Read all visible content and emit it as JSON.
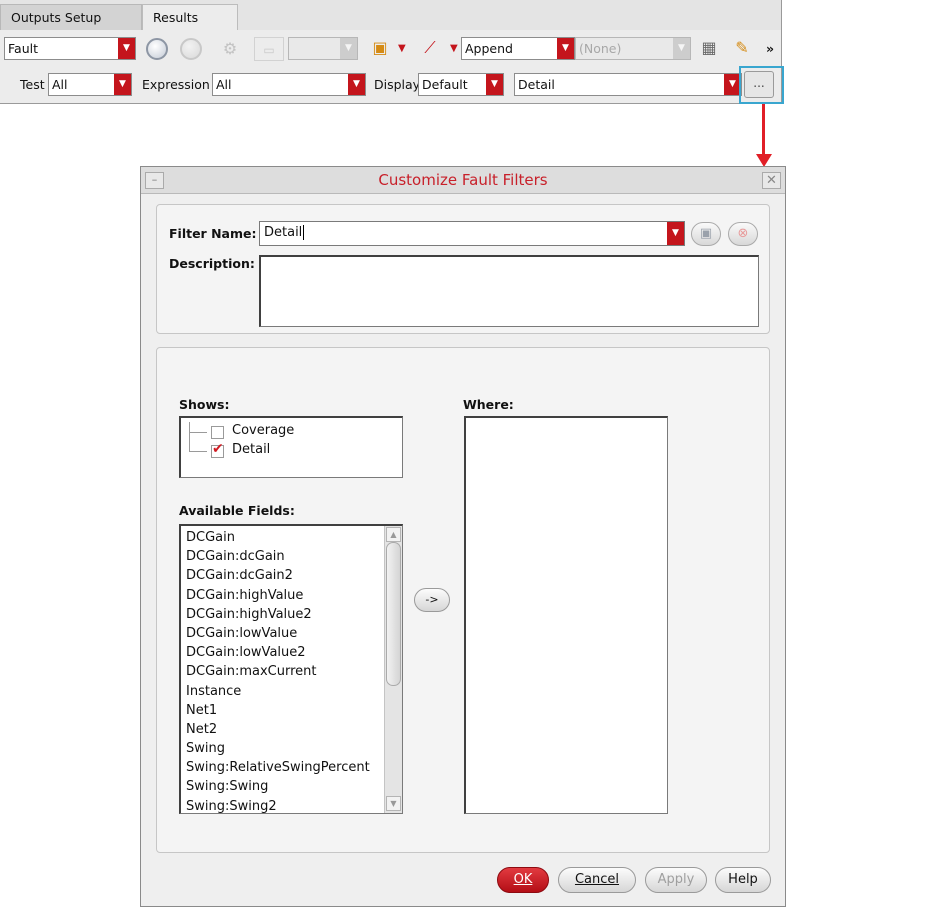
{
  "tabs": [
    {
      "label": "Outputs Setup",
      "active": false
    },
    {
      "label": "Results",
      "active": true
    }
  ],
  "toolbar1": {
    "mode_value": "Fault",
    "append_value": "Append",
    "none_value": "(None)",
    "overflow": "»"
  },
  "toolbar2": {
    "test_label": "Test",
    "test_value": "All",
    "expression_label": "Expression",
    "expression_value": "All",
    "display_label": "Display",
    "display_value": "Default",
    "filter_value": "Detail",
    "more_button": "..."
  },
  "dialog": {
    "title": "Customize Fault Filters",
    "filter_name_label": "Filter Name:",
    "filter_name_value": "Detail",
    "description_label": "Description:",
    "description_value": "",
    "shows_label": "Shows:",
    "shows_items": [
      {
        "label": "Coverage",
        "checked": false
      },
      {
        "label": "Detail",
        "checked": true
      }
    ],
    "available_fields_label": "Available Fields:",
    "available_fields": [
      "DCGain",
      "DCGain:dcGain",
      "DCGain:dcGain2",
      "DCGain:highValue",
      "DCGain:highValue2",
      "DCGain:lowValue",
      "DCGain:lowValue2",
      "DCGain:maxCurrent",
      "Instance",
      "Net1",
      "Net2",
      "Swing",
      "Swing:RelativeSwingPercent",
      "Swing:Swing",
      "Swing:Swing2"
    ],
    "move_button": "->",
    "where_label": "Where:",
    "buttons": {
      "ok": "OK",
      "cancel": "Cancel",
      "apply": "Apply",
      "help": "Help"
    }
  },
  "colors": {
    "accent_red": "#c4151c",
    "title_red": "#c8202a",
    "highlight_blue": "#39a6cf",
    "arrow_red": "#e11f27"
  }
}
